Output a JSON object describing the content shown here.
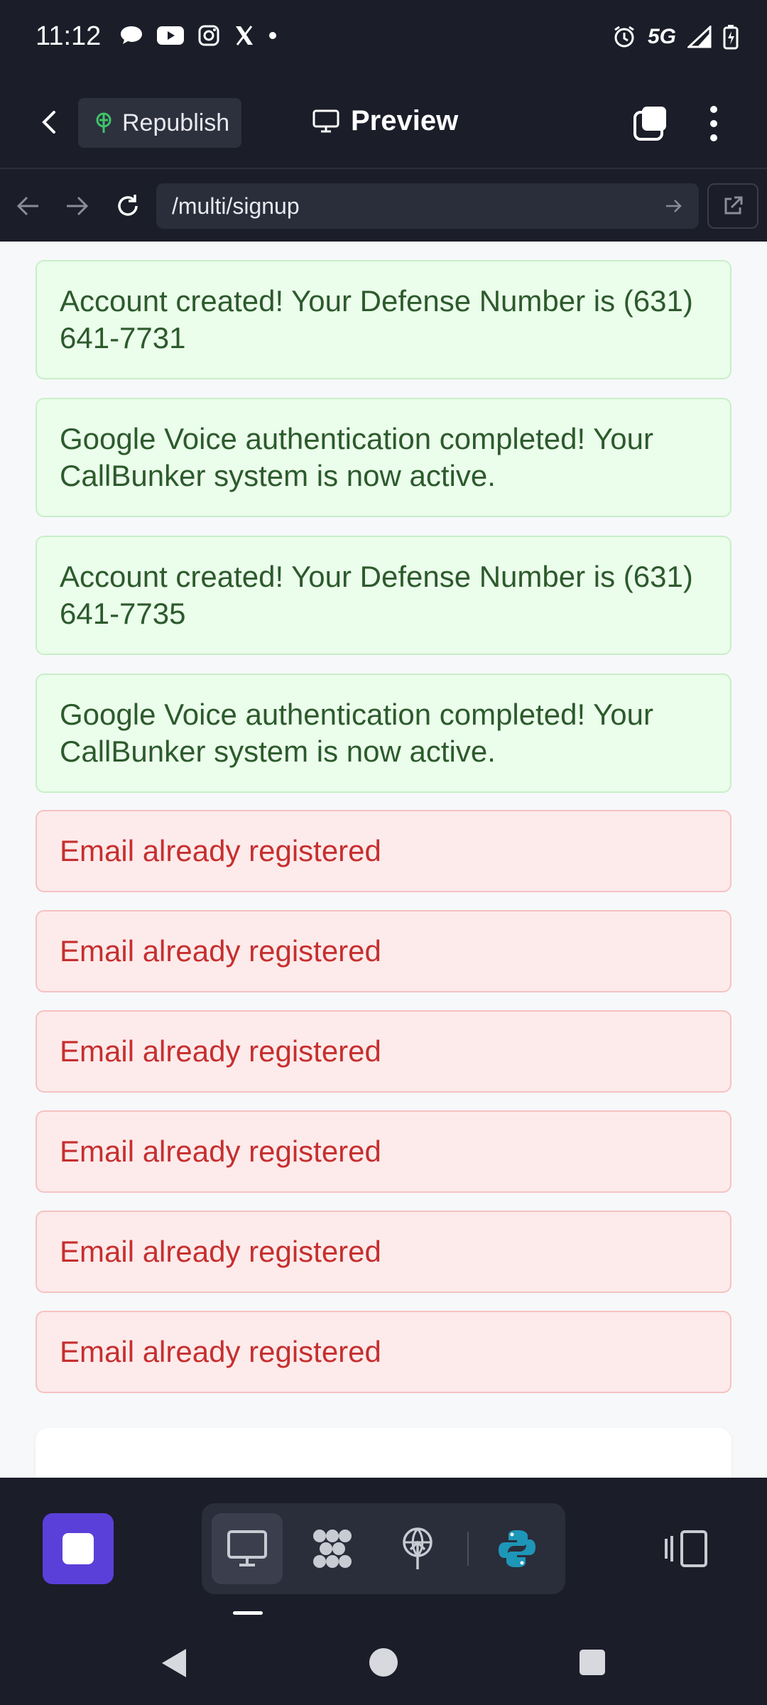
{
  "status_bar": {
    "time": "11:12",
    "left_icons": [
      "messages-icon",
      "youtube-icon",
      "instagram-icon",
      "x-icon",
      "dot-icon"
    ],
    "network": "5G",
    "right_icons": [
      "alarm-icon",
      "signal-icon",
      "battery-icon"
    ]
  },
  "app_bar": {
    "republish_label": "Republish",
    "title": "Preview"
  },
  "url_bar": {
    "path": "/multi/signup"
  },
  "messages": [
    {
      "type": "success",
      "text": "Account created! Your Defense Number is (631) 641-7731"
    },
    {
      "type": "success",
      "text": "Google Voice authentication completed! Your CallBunker system is now active."
    },
    {
      "type": "success",
      "text": "Account created! Your Defense Number is (631) 641-7735"
    },
    {
      "type": "success",
      "text": "Google Voice authentication completed! Your CallBunker system is now active."
    },
    {
      "type": "error",
      "text": "Email already registered"
    },
    {
      "type": "error",
      "text": "Email already registered"
    },
    {
      "type": "error",
      "text": "Email already registered"
    },
    {
      "type": "error",
      "text": "Email already registered"
    },
    {
      "type": "error",
      "text": "Email already registered"
    },
    {
      "type": "error",
      "text": "Email already registered"
    }
  ],
  "colors": {
    "success_bg": "#ebfdeb",
    "success_text": "#2c5a2c",
    "error_bg": "#fdeaea",
    "error_text": "#c62f2f",
    "accent": "#5b3fd9",
    "python_blue": "#1e96b8"
  },
  "toolbar": {
    "tools": [
      "preview-icon",
      "workflow-icon",
      "deploy-icon",
      "python-icon"
    ],
    "devices_icon": "devices-icon"
  }
}
